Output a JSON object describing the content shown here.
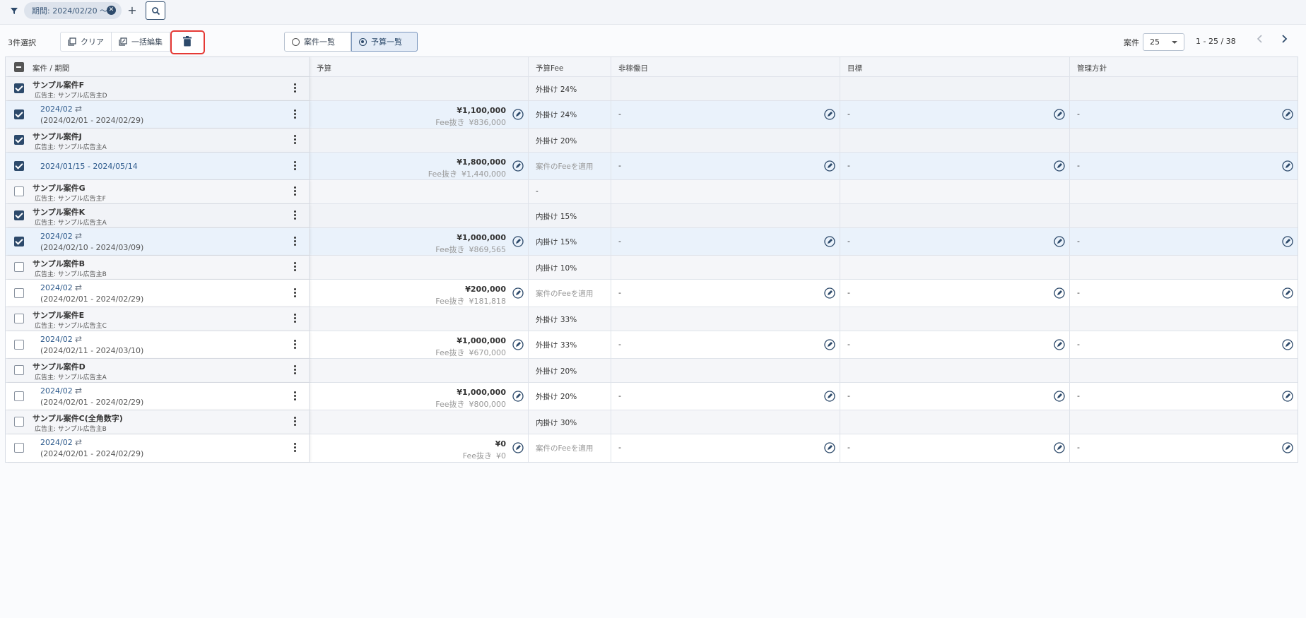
{
  "filter": {
    "chip_label": "期間: 2024/02/20 〜",
    "add_label": "+"
  },
  "toolbar": {
    "selected_count": "3件選択",
    "clear_label": "クリア",
    "bulk_edit_label": "一括編集"
  },
  "view": {
    "option_projects": "案件一覧",
    "option_budget": "予算一覧"
  },
  "pager": {
    "label": "案件",
    "per_page": "25",
    "range": "1 - 25 / 38"
  },
  "columns": [
    "案件 / 期間",
    "予算",
    "予算Fee",
    "非稼働日",
    "目標",
    "管理方針"
  ],
  "rows": [
    {
      "type": "parent",
      "checked": true,
      "name": "サンプル案件F",
      "advertiser": "広告主: サンプル広告主D",
      "fee": "外掛け 24%"
    },
    {
      "type": "child",
      "checked": true,
      "period": "2024/02",
      "range": "(2024/02/01 - 2024/02/29)",
      "budget": "¥1,100,000",
      "fee_label": "Fee抜き",
      "fee_value": "¥836,000",
      "fee": "外掛け 24%",
      "downtime": "-",
      "goal": "-",
      "policy": "-"
    },
    {
      "type": "parent",
      "checked": true,
      "name": "サンプル案件J",
      "advertiser": "広告主: サンプル広告主A",
      "fee": "外掛け 20%"
    },
    {
      "type": "child",
      "checked": true,
      "period": "2024/01/15 - 2024/05/14",
      "range": "",
      "budget": "¥1,800,000",
      "fee_label": "Fee抜き",
      "fee_value": "¥1,440,000",
      "fee": "案件のFeeを適用",
      "fee_muted": true,
      "downtime": "-",
      "goal": "-",
      "policy": "-"
    },
    {
      "type": "parent",
      "checked": false,
      "name": "サンプル案件G",
      "advertiser": "広告主: サンプル広告主F",
      "fee": "-"
    },
    {
      "type": "parent",
      "checked": true,
      "name": "サンプル案件K",
      "advertiser": "広告主: サンプル広告主A",
      "fee": "内掛け 15%"
    },
    {
      "type": "child",
      "checked": true,
      "period": "2024/02",
      "range": "(2024/02/10 - 2024/03/09)",
      "budget": "¥1,000,000",
      "fee_label": "Fee抜き",
      "fee_value": "¥869,565",
      "fee": "内掛け 15%",
      "downtime": "-",
      "goal": "-",
      "policy": "-"
    },
    {
      "type": "parent",
      "checked": false,
      "name": "サンプル案件B",
      "advertiser": "広告主: サンプル広告主B",
      "fee": "内掛け 10%"
    },
    {
      "type": "child",
      "checked": false,
      "period": "2024/02",
      "range": "(2024/02/01 - 2024/02/29)",
      "budget": "¥200,000",
      "fee_label": "Fee抜き",
      "fee_value": "¥181,818",
      "fee": "案件のFeeを適用",
      "fee_muted": true,
      "downtime": "-",
      "goal": "-",
      "policy": "-"
    },
    {
      "type": "parent",
      "checked": false,
      "name": "サンプル案件E",
      "advertiser": "広告主: サンプル広告主C",
      "fee": "外掛け 33%"
    },
    {
      "type": "child",
      "checked": false,
      "period": "2024/02",
      "range": "(2024/02/11 - 2024/03/10)",
      "budget": "¥1,000,000",
      "fee_label": "Fee抜き",
      "fee_value": "¥670,000",
      "fee": "外掛け 33%",
      "downtime": "-",
      "goal": "-",
      "policy": "-"
    },
    {
      "type": "parent",
      "checked": false,
      "name": "サンプル案件D",
      "advertiser": "広告主: サンプル広告主A",
      "fee": "外掛け 20%"
    },
    {
      "type": "child",
      "checked": false,
      "period": "2024/02",
      "range": "(2024/02/01 - 2024/02/29)",
      "budget": "¥1,000,000",
      "fee_label": "Fee抜き",
      "fee_value": "¥800,000",
      "fee": "外掛け 20%",
      "downtime": "-",
      "goal": "-",
      "policy": "-"
    },
    {
      "type": "parent",
      "checked": false,
      "name": "サンプル案件C(全角数字)",
      "advertiser": "広告主: サンプル広告主B",
      "fee": "内掛け 30%"
    },
    {
      "type": "child",
      "checked": false,
      "period": "2024/02",
      "range": "(2024/02/01 - 2024/02/29)",
      "budget": "¥0",
      "fee_label": "Fee抜き",
      "fee_value": "¥0",
      "fee": "案件のFeeを適用",
      "fee_muted": true,
      "downtime": "-",
      "goal": "-",
      "policy": "-"
    }
  ],
  "colors": {
    "accent": "#2d4a6b",
    "highlight": "#e53935",
    "selected_row": "#eaf2fb"
  }
}
